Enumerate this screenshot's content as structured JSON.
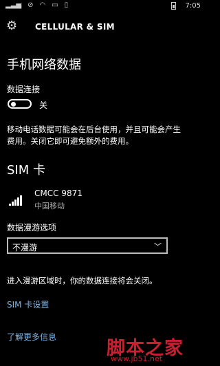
{
  "status": {
    "time": "7:05"
  },
  "header": {
    "title": "CELLULAR & SIM",
    "icon": "gear-icon"
  },
  "cellular": {
    "heading": "手机网络数据",
    "data_connection_label": "数据连接",
    "toggle_state": "关",
    "toggle_on": false,
    "description_line1": "移动电话数据可能会在后台使用，并且可能会产生",
    "description_line2": "费用。关闭它即可避免额外的费用。"
  },
  "sim": {
    "heading": "SIM 卡",
    "carrier_name": "CMCC 9871",
    "carrier_sub": "中国移动",
    "roaming_label": "数据漫游选项",
    "roaming_value": "不漫游",
    "roaming_note": "进入漫游区域时，你的数据连接将会关闭。",
    "sim_settings_link": "SIM 卡设置",
    "learn_more_link": "了解更多信息"
  },
  "watermark": {
    "main": "脚本之家",
    "url": "www.jb51.net"
  },
  "colors": {
    "link": "#7fb5e6",
    "watermark": "#c8202f"
  }
}
